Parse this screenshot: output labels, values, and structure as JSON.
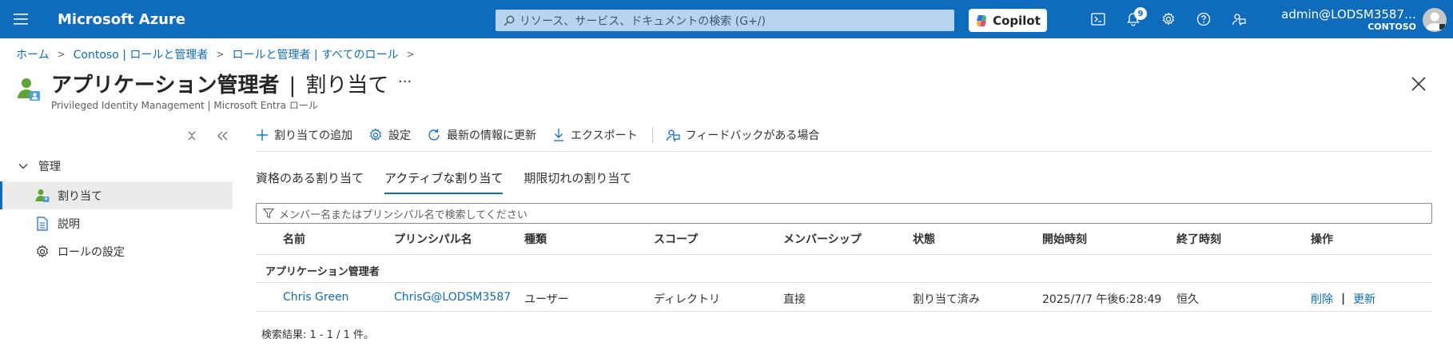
{
  "topbar": {
    "brand": "Microsoft Azure",
    "search_placeholder": "リソース、サービス、ドキュメントの検索 (G+/)",
    "copilot_label": "Copilot",
    "notification_count": "9",
    "account_user": "admin@LODSM3587…",
    "account_tenant": "CONTOSO"
  },
  "breadcrumb": {
    "items": [
      "ホーム",
      "Contoso | ロールと管理者",
      "ロールと管理者 | すべてのロール"
    ]
  },
  "header": {
    "title": "アプリケーション管理者",
    "title_separator": "|",
    "title_suffix": "割り当て",
    "more": "···",
    "subtitle": "Privileged Identity Management | Microsoft Entra ロール"
  },
  "sidebar": {
    "group_label": "管理",
    "items": [
      {
        "label": "割り当て",
        "icon": "user-assignment-icon",
        "active": true
      },
      {
        "label": "説明",
        "icon": "document-icon",
        "active": false
      },
      {
        "label": "ロールの設定",
        "icon": "gear-icon",
        "active": false
      }
    ]
  },
  "commands": {
    "add": "割り当ての追加",
    "settings": "設定",
    "refresh": "最新の情報に更新",
    "export": "エクスポート",
    "feedback": "フィードバックがある場合"
  },
  "tabs": [
    "資格のある割り当て",
    "アクティブな割り当て",
    "期限切れの割り当て"
  ],
  "active_tab": "アクティブな割り当て",
  "filter": {
    "placeholder": "メンバー名またはプリンシパル名で検索してください"
  },
  "table": {
    "columns": [
      "名前",
      "プリンシパル名",
      "種類",
      "スコープ",
      "メンバーシップ",
      "状態",
      "開始時刻",
      "終了時刻",
      "操作"
    ],
    "group_label": "アプリケーション管理者",
    "rows": [
      {
        "name": "Chris Green",
        "principal": "ChrisG@LODSM3587",
        "type": "ユーザー",
        "scope": "ディレクトリ",
        "membership": "直接",
        "state": "割り当て済み",
        "start": "2025/7/7 午後6:28:49",
        "end": "恒久",
        "action_remove": "削除",
        "action_separator": "|",
        "action_update": "更新"
      }
    ]
  },
  "results_text": "検索結果: 1 - 1 / 1 件。",
  "colors": {
    "brand_blue": "#0f6cbd",
    "selected_nav": "#edebe9"
  }
}
